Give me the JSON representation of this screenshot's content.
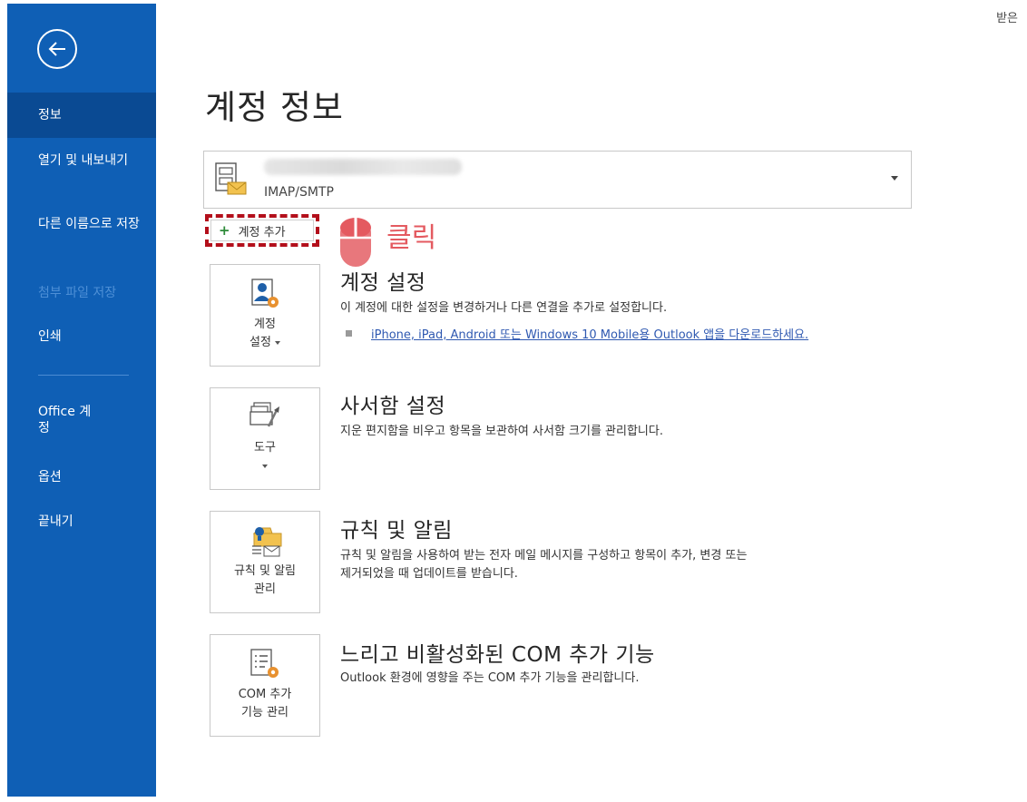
{
  "sidebar": {
    "items": [
      {
        "label": "정보"
      },
      {
        "label": "열기 및 내보내기"
      },
      {
        "label": "다른 이름으로 저장"
      },
      {
        "label": "첨부 파일 저장"
      },
      {
        "label": "인쇄"
      },
      {
        "label": "Office 계정"
      },
      {
        "label": "옵션"
      },
      {
        "label": "끝내기"
      }
    ],
    "back_icon": "back-arrow-icon",
    "bg_color": "#0f5fb5",
    "active_color": "#0a4a93"
  },
  "top_right": "받은",
  "page_title": "계정 정보",
  "account": {
    "type": "IMAP/SMTP"
  },
  "add_account": {
    "label": "계정 추가"
  },
  "annotation": {
    "label": "클릭",
    "color": "#e45a60",
    "highlight_color": "#b30f1b"
  },
  "sections": [
    {
      "tile_line1": "계정",
      "tile_line2": "설정",
      "title": "계정 설정",
      "desc": "이 계정에 대한 설정을 변경하거나 다른 연결을 추가로 설정합니다.",
      "link": "iPhone, iPad, Android 또는 Windows 10 Mobile용 Outlook 앱을 다운로드하세요."
    },
    {
      "tile_line1": "도구",
      "title": "사서함 설정",
      "desc": "지운 편지함을 비우고 항목을 보관하여 사서함 크기를 관리합니다."
    },
    {
      "tile_line1": "규칙 및 알림",
      "tile_line2": "관리",
      "title": "규칙 및 알림",
      "desc_line1": "규칙 및 알림을 사용하여 받는 전자 메일 메시지를 구성하고 항목이 추가, 변경 또는",
      "desc_line2": "제거되었을 때 업데이트를 받습니다."
    },
    {
      "tile_line1": "COM 추가",
      "tile_line2": "기능 관리",
      "title": "느리고 비활성화된 COM 추가 기능",
      "desc": "Outlook 환경에 영향을 주는 COM 추가 기능을 관리합니다."
    }
  ]
}
